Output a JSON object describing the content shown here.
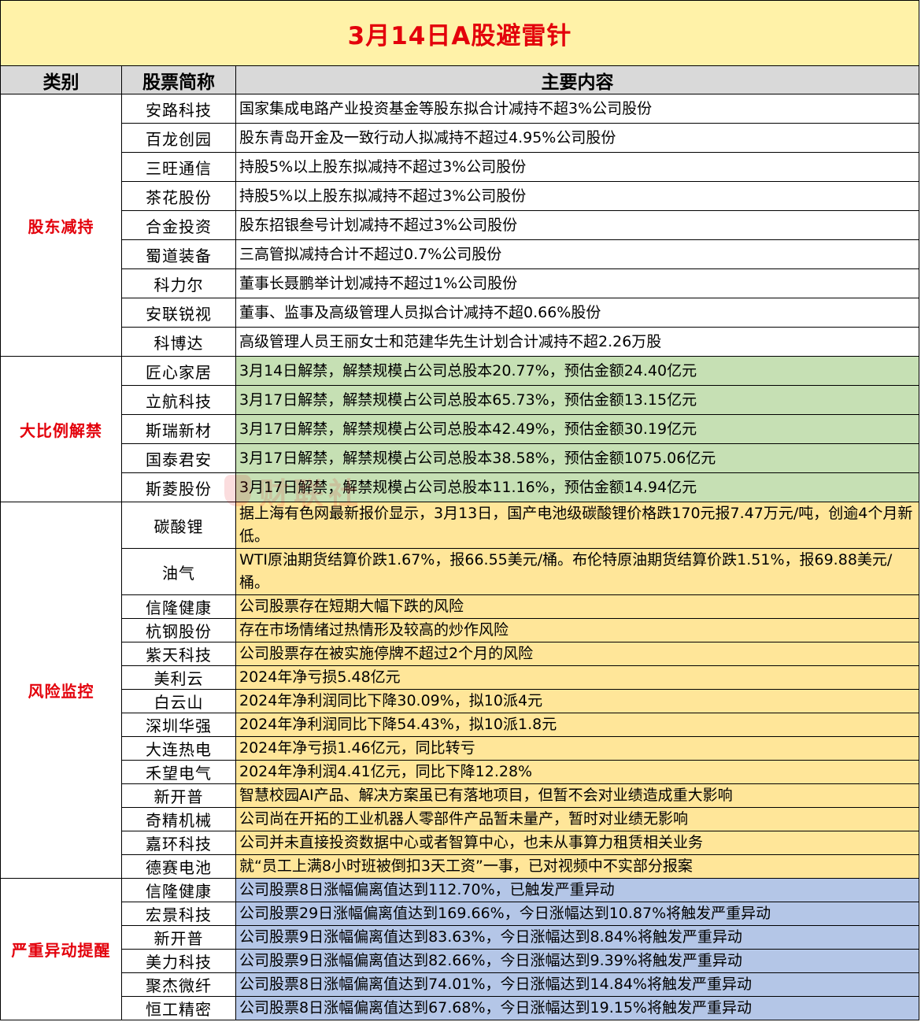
{
  "title": "3月14日A股避雷针",
  "colors": {
    "title_bg": "#FFF2A8",
    "title_text": "#E3000B",
    "header_bg": "#D9D9D9",
    "category_text": "#E3000B",
    "section_bg": [
      "#FFFFFF",
      "#C6E0B4",
      "#FFE699",
      "#B4C6E7"
    ]
  },
  "headers": [
    "类别",
    "股票简称",
    "主要内容"
  ],
  "watermark_text": "财联社",
  "sections": [
    {
      "category": "股东减持",
      "rows": [
        {
          "name": "安路科技",
          "content": "国家集成电路产业投资基金等股东拟合计减持不超3%公司股份"
        },
        {
          "name": "百龙创园",
          "content": "股东青岛开金及一致行动人拟减持不超过4.95%公司股份"
        },
        {
          "name": "三旺通信",
          "content": "持股5%以上股东拟减持不超过3%公司股份"
        },
        {
          "name": "茶花股份",
          "content": "持股5%以上股东拟减持不超过3%公司股份"
        },
        {
          "name": "合金投资",
          "content": "股东招银叁号计划减持不超过3%公司股份"
        },
        {
          "name": "蜀道装备",
          "content": "三高管拟减持合计不超过0.7%公司股份"
        },
        {
          "name": "科力尔",
          "content": "董事长聂鹏举计划减持不超过1%公司股份"
        },
        {
          "name": "安联锐视",
          "content": "董事、监事及高级管理人员拟合计减持不超0.66%股份"
        },
        {
          "name": "科博达",
          "content": "高级管理人员王丽女士和范建华先生计划合计减持不超2.26万股"
        }
      ]
    },
    {
      "category": "大比例解禁",
      "rows": [
        {
          "name": "匠心家居",
          "content": "3月14日解禁，解禁规模占公司总股本20.77%，预估金额24.40亿元"
        },
        {
          "name": "立航科技",
          "content": "3月17日解禁，解禁规模占公司总股本65.73%，预估金额13.15亿元"
        },
        {
          "name": "斯瑞新材",
          "content": "3月17日解禁，解禁规模占公司总股本42.49%，预估金额30.19亿元"
        },
        {
          "name": "国泰君安",
          "content": "3月17日解禁，解禁规模占公司总股本38.58%，预估金额1075.06亿元"
        },
        {
          "name": "斯菱股份",
          "content": "3月17日解禁，解禁规模占公司总股本11.16%，预估金额14.94亿元"
        }
      ]
    },
    {
      "category": "风险监控",
      "rows": [
        {
          "name": "碳酸锂",
          "content": "据上海有色网最新报价显示，3月13日，国产电池级碳酸锂价格跌170元报7.47万元/吨，创逾4个月新低。"
        },
        {
          "name": "油气",
          "content": "WTI原油期货结算价跌1.67%，报66.55美元/桶。布伦特原油期货结算价跌1.51%，报69.88美元/桶。"
        },
        {
          "name": "信隆健康",
          "content": "公司股票存在短期大幅下跌的风险"
        },
        {
          "name": "杭钢股份",
          "content": "存在市场情绪过热情形及较高的炒作风险"
        },
        {
          "name": "紫天科技",
          "content": "公司股票存在被实施停牌不超过2个月的风险"
        },
        {
          "name": "美利云",
          "content": "2024年净亏损5.48亿元"
        },
        {
          "name": "白云山",
          "content": "2024年净利润同比下降30.09%，拟10派4元"
        },
        {
          "name": "深圳华强",
          "content": "2024年净利润同比下降54.43%，拟10派1.8元"
        },
        {
          "name": "大连热电",
          "content": "2024年净亏损1.46亿元，同比转亏"
        },
        {
          "name": "禾望电气",
          "content": "2024年净利润4.41亿元，同比下降12.28%"
        },
        {
          "name": "新开普",
          "content": "智慧校园AI产品、解决方案虽已有落地项目，但暂不会对业绩造成重大影响"
        },
        {
          "name": "奇精机械",
          "content": "公司尚在开拓的工业机器人零部件产品暂未量产，暂时对业绩无影响"
        },
        {
          "name": "嘉环科技",
          "content": "公司并未直接投资数据中心或者智算中心，也未从事算力租赁相关业务"
        },
        {
          "name": "德赛电池",
          "content": "就“员工上满8小时班被倒扣3天工资”一事，已对视频中不实部分报案"
        }
      ]
    },
    {
      "category": "严重异动提醒",
      "rows": [
        {
          "name": "信隆健康",
          "content": "公司股票8日涨幅偏离值达到112.70%，已触发严重异动"
        },
        {
          "name": "宏景科技",
          "content": "公司股票29日涨幅偏离值达到169.66%，今日涨幅达到10.87%将触发严重异动"
        },
        {
          "name": "新开普",
          "content": "公司股票9日涨幅偏离值达到83.63%，今日涨幅达到8.84%将触发严重异动"
        },
        {
          "name": "美力科技",
          "content": "公司股票9日涨幅偏离值达到82.66%，今日涨幅达到9.39%将触发严重异动"
        },
        {
          "name": "聚杰微纤",
          "content": "公司股票8日涨幅偏离值达到74.01%，今日涨幅达到14.84%将触发严重异动"
        },
        {
          "name": "恒工精密",
          "content": "公司股票8日涨幅偏离值达到67.68%，今日涨幅达到19.15%将触发严重异动"
        }
      ]
    }
  ]
}
